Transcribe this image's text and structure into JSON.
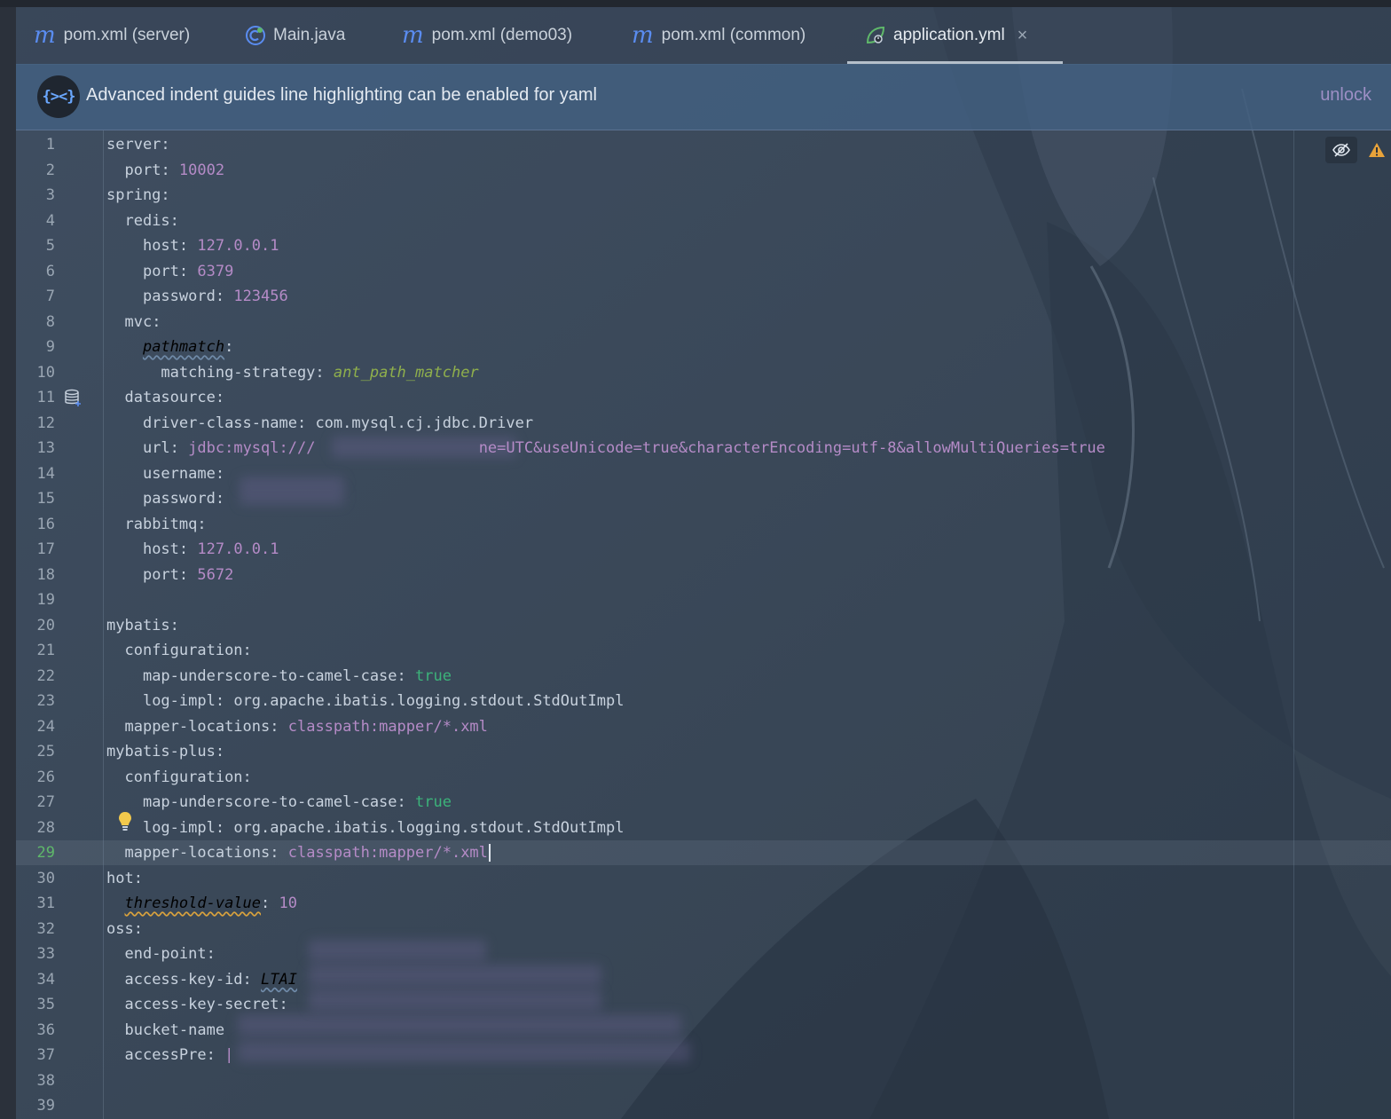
{
  "tabs": [
    {
      "label": "pom.xml (server)",
      "icon": "maven-icon",
      "glyph": "m"
    },
    {
      "label": "Main.java",
      "icon": "java-class-icon",
      "glyph": ""
    },
    {
      "label": "pom.xml (demo03)",
      "icon": "maven-icon",
      "glyph": "m"
    },
    {
      "label": "pom.xml (common)",
      "icon": "maven-icon",
      "glyph": "m"
    },
    {
      "label": "application.yml",
      "icon": "spring-yaml-icon",
      "glyph": "",
      "active": true,
      "close": "×"
    }
  ],
  "banner": {
    "logo_text": "{><}",
    "text": "Advanced indent guides line highlighting can be enabled for yaml",
    "action": "unlock"
  },
  "editor": {
    "current_line": 29,
    "lines": [
      {
        "n": "1",
        "c": [
          [
            "k",
            "server"
          ],
          [
            "p",
            ":"
          ]
        ]
      },
      {
        "n": "2",
        "c": [
          [
            "p",
            "  "
          ],
          [
            "k",
            "port"
          ],
          [
            "p",
            ": "
          ],
          [
            "n",
            "10002"
          ]
        ]
      },
      {
        "n": "3",
        "c": [
          [
            "k",
            "spring"
          ],
          [
            "p",
            ":"
          ]
        ]
      },
      {
        "n": "4",
        "c": [
          [
            "p",
            "  "
          ],
          [
            "k",
            "redis"
          ],
          [
            "p",
            ":"
          ]
        ]
      },
      {
        "n": "5",
        "c": [
          [
            "p",
            "    "
          ],
          [
            "k",
            "host"
          ],
          [
            "p",
            ": "
          ],
          [
            "s",
            "127.0.0.1"
          ]
        ]
      },
      {
        "n": "6",
        "c": [
          [
            "p",
            "    "
          ],
          [
            "k",
            "port"
          ],
          [
            "p",
            ": "
          ],
          [
            "n",
            "6379"
          ]
        ]
      },
      {
        "n": "7",
        "c": [
          [
            "p",
            "    "
          ],
          [
            "k",
            "password"
          ],
          [
            "p",
            ": "
          ],
          [
            "n",
            "123456"
          ]
        ]
      },
      {
        "n": "8",
        "c": [
          [
            "p",
            "  "
          ],
          [
            "k",
            "mvc"
          ],
          [
            "p",
            ":"
          ]
        ]
      },
      {
        "n": "9",
        "c": [
          [
            "p",
            "    "
          ],
          [
            "weak",
            "pathmatch"
          ],
          [
            "p",
            ":"
          ]
        ]
      },
      {
        "n": "10",
        "c": [
          [
            "p",
            "      "
          ],
          [
            "k",
            "matching-strategy"
          ],
          [
            "p",
            ": "
          ],
          [
            "i",
            "ant_path_matcher"
          ]
        ]
      },
      {
        "n": "11",
        "c": [
          [
            "p",
            "  "
          ],
          [
            "k",
            "datasource"
          ],
          [
            "p",
            ":"
          ]
        ],
        "gutter": "database-icon"
      },
      {
        "n": "12",
        "c": [
          [
            "p",
            "    "
          ],
          [
            "k",
            "driver-class-name"
          ],
          [
            "p",
            ": "
          ],
          [
            "j",
            "com.mysql.cj.jdbc.Driver"
          ]
        ]
      },
      {
        "n": "13",
        "c": [
          [
            "p",
            "    "
          ],
          [
            "k",
            "url"
          ],
          [
            "p",
            ": "
          ],
          [
            "s",
            "jdbc:mysql:///"
          ],
          [
            "p",
            "                  "
          ],
          [
            "s",
            "ne=UTC&useUnicode=true&characterEncoding=utf-8&allowMultiQueries=true"
          ]
        ]
      },
      {
        "n": "14",
        "c": [
          [
            "p",
            "    "
          ],
          [
            "k",
            "username"
          ],
          [
            "p",
            ":"
          ]
        ]
      },
      {
        "n": "15",
        "c": [
          [
            "p",
            "    "
          ],
          [
            "k",
            "password"
          ],
          [
            "p",
            ":"
          ]
        ]
      },
      {
        "n": "16",
        "c": [
          [
            "p",
            "  "
          ],
          [
            "k",
            "rabbitmq"
          ],
          [
            "p",
            ":"
          ]
        ]
      },
      {
        "n": "17",
        "c": [
          [
            "p",
            "    "
          ],
          [
            "k",
            "host"
          ],
          [
            "p",
            ": "
          ],
          [
            "s",
            "127.0.0.1"
          ]
        ]
      },
      {
        "n": "18",
        "c": [
          [
            "p",
            "    "
          ],
          [
            "k",
            "port"
          ],
          [
            "p",
            ": "
          ],
          [
            "n",
            "5672"
          ]
        ]
      },
      {
        "n": "19",
        "c": []
      },
      {
        "n": "20",
        "c": [
          [
            "k",
            "mybatis"
          ],
          [
            "p",
            ":"
          ]
        ]
      },
      {
        "n": "21",
        "c": [
          [
            "p",
            "  "
          ],
          [
            "k",
            "configuration"
          ],
          [
            "p",
            ":"
          ]
        ]
      },
      {
        "n": "22",
        "c": [
          [
            "p",
            "    "
          ],
          [
            "k",
            "map-underscore-to-camel-case"
          ],
          [
            "p",
            ": "
          ],
          [
            "b",
            "true"
          ]
        ]
      },
      {
        "n": "23",
        "c": [
          [
            "p",
            "    "
          ],
          [
            "k",
            "log-impl"
          ],
          [
            "p",
            ": "
          ],
          [
            "j",
            "org.apache.ibatis.logging.stdout.StdOutImpl"
          ]
        ]
      },
      {
        "n": "24",
        "c": [
          [
            "p",
            "  "
          ],
          [
            "k",
            "mapper-locations"
          ],
          [
            "p",
            ": "
          ],
          [
            "s",
            "classpath:mapper/*.xml"
          ]
        ]
      },
      {
        "n": "25",
        "c": [
          [
            "k",
            "mybatis-plus"
          ],
          [
            "p",
            ":"
          ]
        ]
      },
      {
        "n": "26",
        "c": [
          [
            "p",
            "  "
          ],
          [
            "k",
            "configuration"
          ],
          [
            "p",
            ":"
          ]
        ]
      },
      {
        "n": "27",
        "c": [
          [
            "p",
            "    "
          ],
          [
            "k",
            "map-underscore-to-camel-case"
          ],
          [
            "p",
            ": "
          ],
          [
            "b",
            "true"
          ]
        ]
      },
      {
        "n": "28",
        "c": [
          [
            "p",
            "    "
          ],
          [
            "k",
            "log-impl"
          ],
          [
            "p",
            ": "
          ],
          [
            "j",
            "org.apache.ibatis.logging.stdout.StdOutImpl"
          ]
        ],
        "gutter": "bulb-icon"
      },
      {
        "n": "29",
        "c": [
          [
            "p",
            "  "
          ],
          [
            "k",
            "mapper-locations"
          ],
          [
            "p",
            ": "
          ],
          [
            "s",
            "classpath:mapper/*.xml"
          ]
        ],
        "caret": true
      },
      {
        "n": "30",
        "c": [
          [
            "k",
            "hot"
          ],
          [
            "p",
            ":"
          ]
        ]
      },
      {
        "n": "31",
        "c": [
          [
            "p",
            "  "
          ],
          [
            "warn",
            "threshold-value"
          ],
          [
            "p",
            ": "
          ],
          [
            "n",
            "10"
          ]
        ]
      },
      {
        "n": "32",
        "c": [
          [
            "k",
            "oss"
          ],
          [
            "p",
            ":"
          ]
        ]
      },
      {
        "n": "33",
        "c": [
          [
            "p",
            "  "
          ],
          [
            "k",
            "end-point"
          ],
          [
            "p",
            ":"
          ]
        ]
      },
      {
        "n": "34",
        "c": [
          [
            "p",
            "  "
          ],
          [
            "k",
            "access-key-id"
          ],
          [
            "p",
            ": "
          ],
          [
            "weak",
            "LTAI"
          ]
        ]
      },
      {
        "n": "35",
        "c": [
          [
            "p",
            "  "
          ],
          [
            "k",
            "access-key-secret"
          ],
          [
            "p",
            ":"
          ]
        ]
      },
      {
        "n": "36",
        "c": [
          [
            "p",
            "  "
          ],
          [
            "k",
            "bucket-name"
          ]
        ]
      },
      {
        "n": "37",
        "c": [
          [
            "p",
            "  "
          ],
          [
            "k",
            "accessPre"
          ],
          [
            "p",
            ": "
          ],
          [
            "s",
            "|"
          ]
        ]
      },
      {
        "n": "38",
        "c": []
      },
      {
        "n": "39",
        "c": []
      }
    ]
  },
  "colors": {
    "background": "#3b4a5c",
    "key": "#c8d2de",
    "number": "#b58bc7",
    "boolean": "#3cb37a",
    "enum": "#8faf4c",
    "accent": "#5a8cf0",
    "current_line_number": "#5fb86a"
  },
  "toolbar_icons": [
    "hide-preview-icon",
    "warning-icon"
  ]
}
